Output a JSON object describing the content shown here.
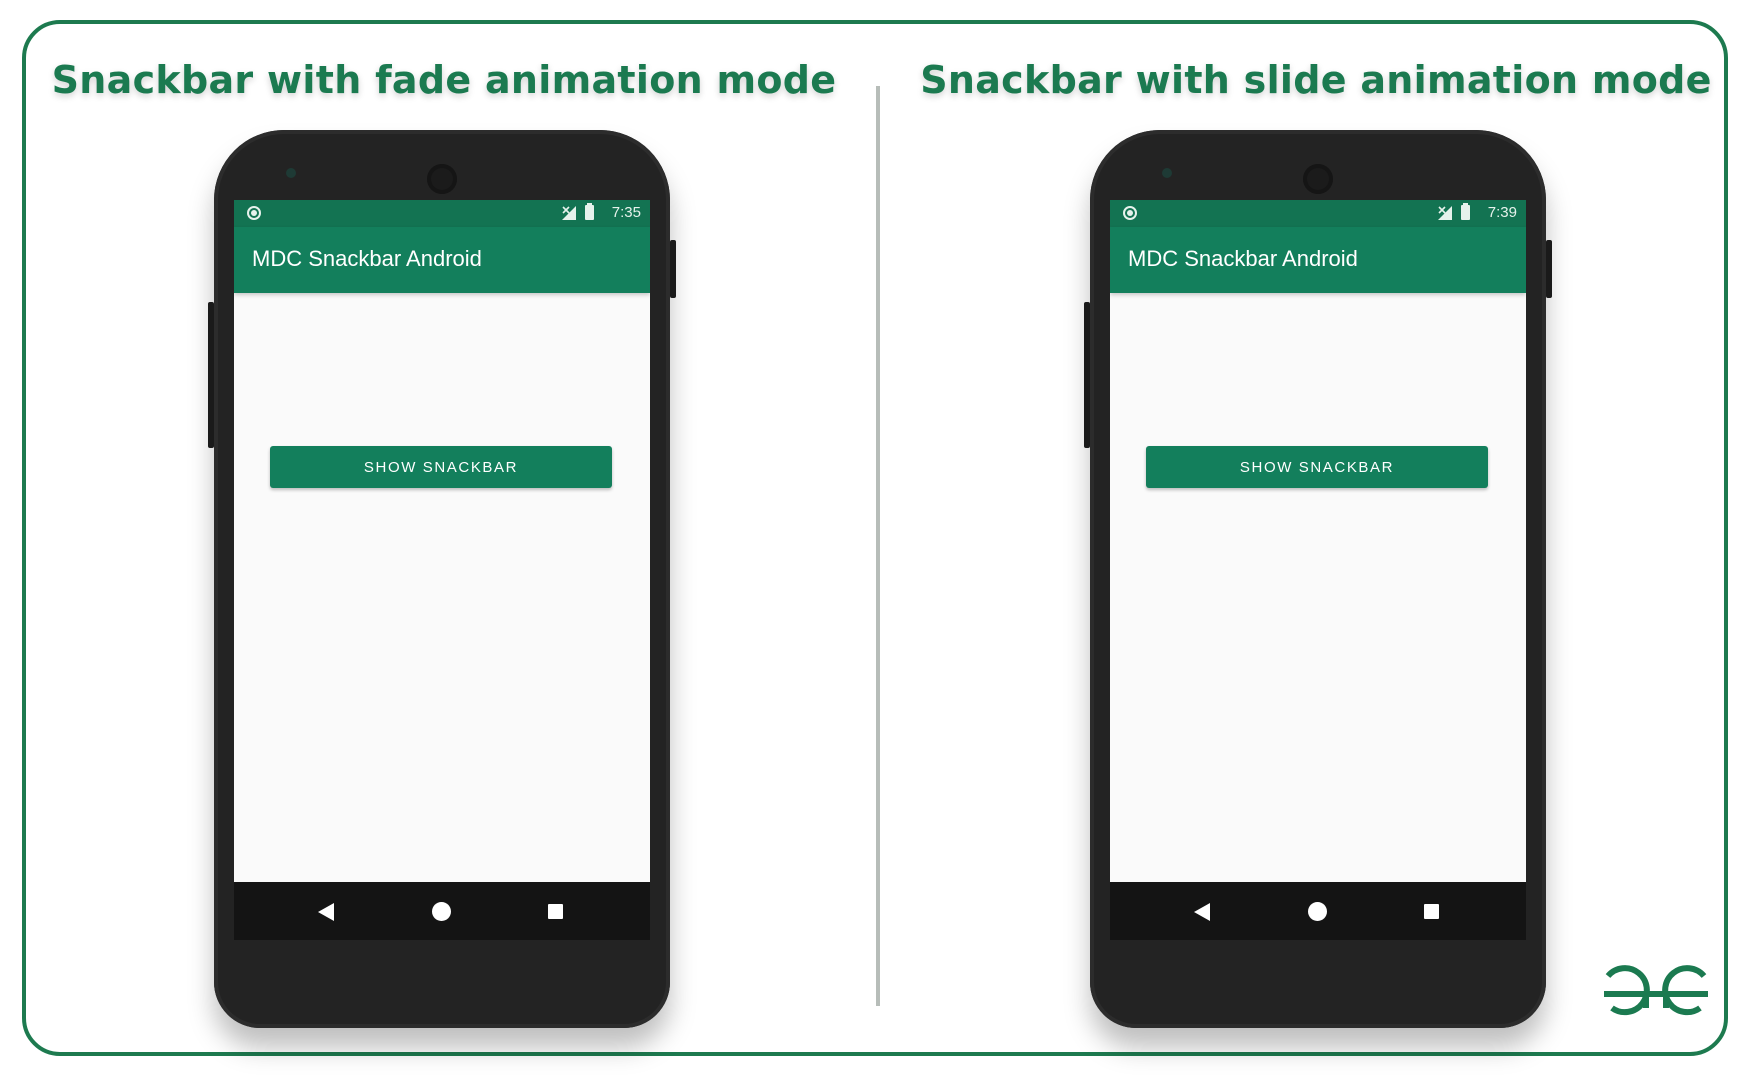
{
  "colors": {
    "brand_green": "#1b7a50",
    "app_bar": "#137f5c",
    "status_bar": "#137352",
    "phone_body": "#232323",
    "nav_bar": "#141414",
    "screen_bg": "#fafafa"
  },
  "panels": [
    {
      "heading": "Snackbar with fade animation mode",
      "status_time": "7:35",
      "app_title": "MDC Snackbar Android",
      "button_label": "SHOW SNACKBAR"
    },
    {
      "heading": "Snackbar with slide animation mode",
      "status_time": "7:39",
      "app_title": "MDC Snackbar Android",
      "button_label": "SHOW SNACKBAR"
    }
  ],
  "icons": {
    "status": [
      "notification-dot-icon",
      "no-signal-icon",
      "battery-icon"
    ],
    "nav": [
      "back-icon",
      "home-icon",
      "recents-icon"
    ],
    "logo": "geeksforgeeks-logo-icon"
  }
}
